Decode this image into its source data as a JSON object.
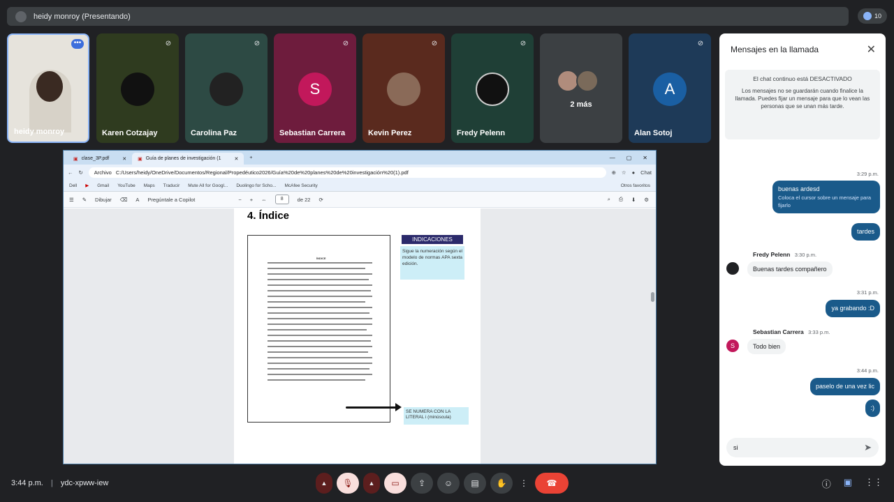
{
  "topbar": {
    "presenter": "heidy monroy (Presentando)",
    "people_count": "10"
  },
  "tiles": [
    {
      "name": "heidy monroy",
      "bg": "#e6e3dc"
    },
    {
      "name": "Karen Cotzajay",
      "bg": "#2f3b1f"
    },
    {
      "name": "Carolina Paz",
      "bg": "#2d4a44"
    },
    {
      "name": "Sebastian Carrera",
      "bg": "#6e1c3d",
      "initial": "S",
      "avatar_color": "#c2185b"
    },
    {
      "name": "Kevin Perez",
      "bg": "#5a2a1e"
    },
    {
      "name": "Fredy Pelenn",
      "bg": "#1f3f36"
    },
    {
      "name": "2 más",
      "bg": "#3c4043"
    },
    {
      "name": "Alan Sotoj",
      "bg": "#1e3a58",
      "initial": "A",
      "avatar_color": "#1a5fa3"
    }
  ],
  "chat": {
    "title": "Mensajes en la llamada",
    "notice_title": "El chat continuo está DESACTIVADO",
    "notice_body": "Los mensajes no se guardarán cuando finalice la llamada. Puedes fijar un mensaje para que lo vean las personas que se unan más tarde.",
    "messages": [
      {
        "time": "3:29 p.m.",
        "text": "buenas ardesd",
        "hint": "Coloca el cursor sobre un mensaje para fijarlo"
      },
      {
        "text": "tardes"
      },
      {
        "sender": "Fredy Pelenn",
        "time": "3:30 p.m.",
        "text": "Buenas tardes compañero"
      },
      {
        "time": "3:31 p.m.",
        "text": "ya grabando :D"
      },
      {
        "sender": "Sebastian Carrera",
        "time": "3:33 p.m.",
        "text": "Todo bien",
        "initial": "S"
      },
      {
        "time": "3:44 p.m.",
        "text": "paselo de una vez lic"
      },
      {
        "text": ":)"
      }
    ],
    "input_value": "si"
  },
  "browser": {
    "tabs": [
      "clase_3P.pdf",
      "Guía de planes de investigación (1"
    ],
    "address_label": "Archivo",
    "url": "C:/Users/heidy/OneDrive/Documentos/Regional/Propedéutico2026/Guía%20de%20planes%20de%20investigación%20(1).pdf",
    "chat_label": "Chat",
    "bookmarks": [
      "Dell",
      "Gmail",
      "YouTube",
      "Maps",
      "Traducir",
      "Mute All for Googl...",
      "Duolingo for Scho...",
      "McAfee Security",
      "Otros favoritos"
    ],
    "pdf_toolbar": {
      "draw": "Dibujar",
      "copilot": "Pregúntale a Copilot",
      "page": "8",
      "of": "de 22"
    },
    "page": {
      "heading": "4. Índice",
      "ind_title": "INDICACIONES",
      "ind_body": "Sigue la numeración según el modelo de normas APA sexta edición.",
      "note": "SE NUMERA CON LA LITERAL i (minúscula)",
      "thumb_title": "ÍNDICE"
    }
  },
  "bottom": {
    "time": "3:44 p.m.",
    "meeting_code": "ydc-xpww-iew"
  }
}
